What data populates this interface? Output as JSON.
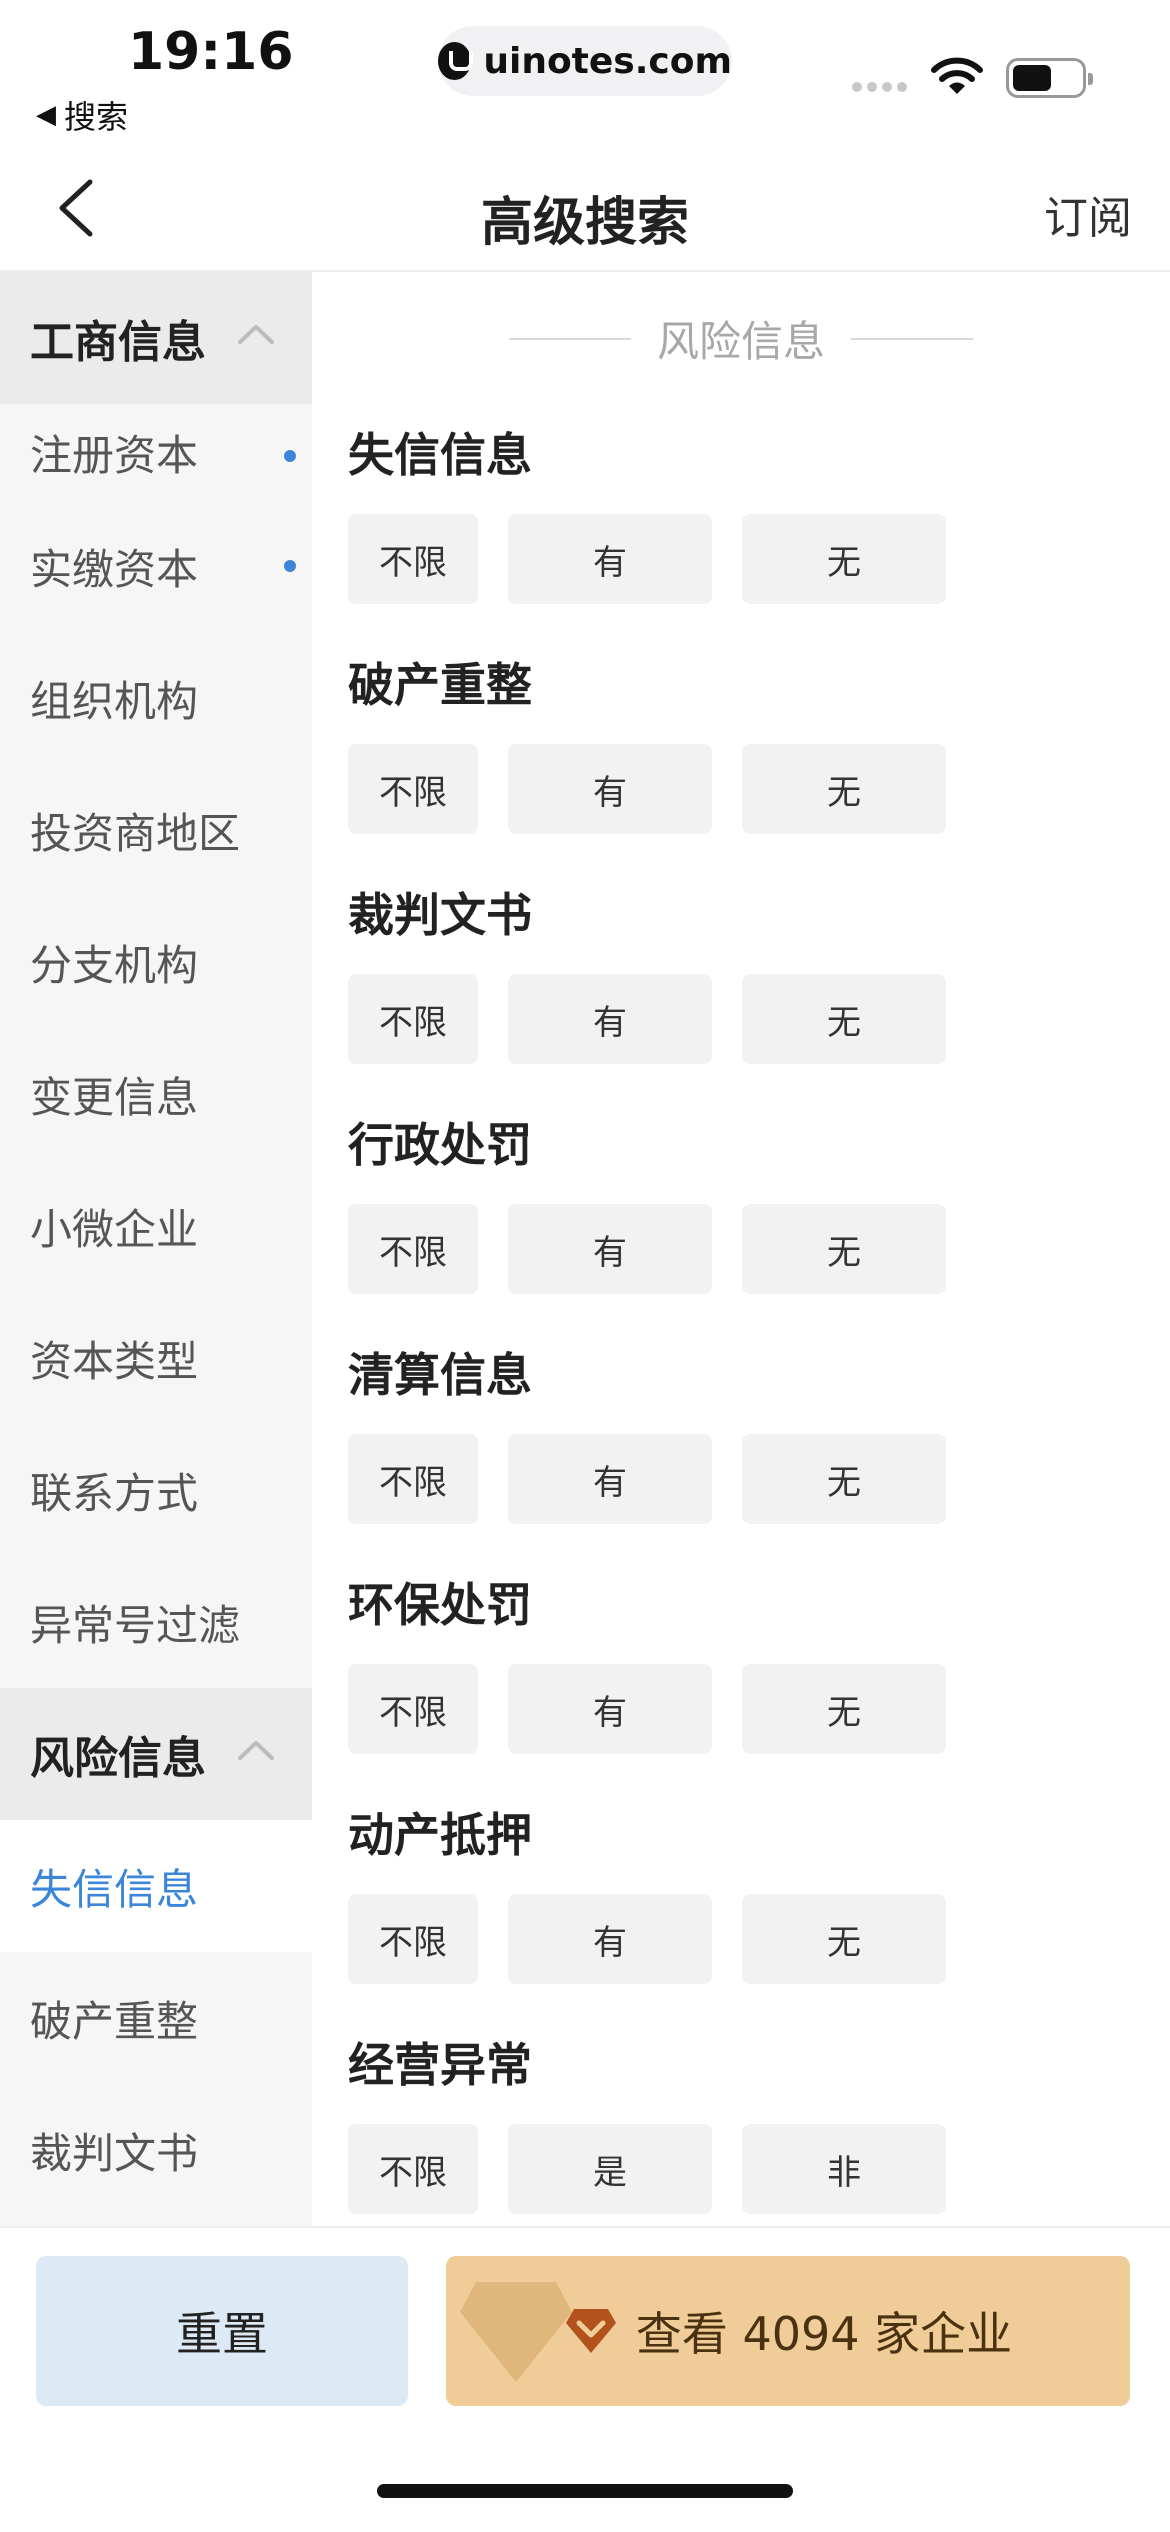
{
  "status_bar": {
    "time": "19:16",
    "back_app": "搜索",
    "url": "uinotes.com"
  },
  "nav": {
    "title": "高级搜索",
    "subscribe": "订阅"
  },
  "sidebar": {
    "groups": [
      {
        "label": "工商信息",
        "items": [
          {
            "label": "注册资本",
            "dot": true
          },
          {
            "label": "实缴资本",
            "dot": true
          },
          {
            "label": "组织机构"
          },
          {
            "label": "投资商地区"
          },
          {
            "label": "分支机构"
          },
          {
            "label": "变更信息"
          },
          {
            "label": "小微企业"
          },
          {
            "label": "资本类型"
          },
          {
            "label": "联系方式"
          },
          {
            "label": "异常号过滤"
          }
        ]
      },
      {
        "label": "风险信息",
        "items": [
          {
            "label": "失信信息",
            "active": true
          },
          {
            "label": "破产重整"
          },
          {
            "label": "裁判文书"
          }
        ]
      }
    ]
  },
  "content": {
    "section_title": "风险信息",
    "filters": [
      {
        "title": "失信信息",
        "options": [
          "不限",
          "有",
          "无"
        ]
      },
      {
        "title": "破产重整",
        "options": [
          "不限",
          "有",
          "无"
        ]
      },
      {
        "title": "裁判文书",
        "options": [
          "不限",
          "有",
          "无"
        ]
      },
      {
        "title": "行政处罚",
        "options": [
          "不限",
          "有",
          "无"
        ]
      },
      {
        "title": "清算信息",
        "options": [
          "不限",
          "有",
          "无"
        ]
      },
      {
        "title": "环保处罚",
        "options": [
          "不限",
          "有",
          "无"
        ]
      },
      {
        "title": "动产抵押",
        "options": [
          "不限",
          "有",
          "无"
        ]
      },
      {
        "title": "经营异常",
        "options": [
          "不限",
          "是",
          "非"
        ]
      }
    ]
  },
  "bottom": {
    "reset_label": "重置",
    "view_label": "查看 4094 家企业"
  },
  "colors": {
    "accent_blue": "#3b86d8",
    "view_button": "#f0cd98",
    "reset_button": "#ddeaf6"
  }
}
